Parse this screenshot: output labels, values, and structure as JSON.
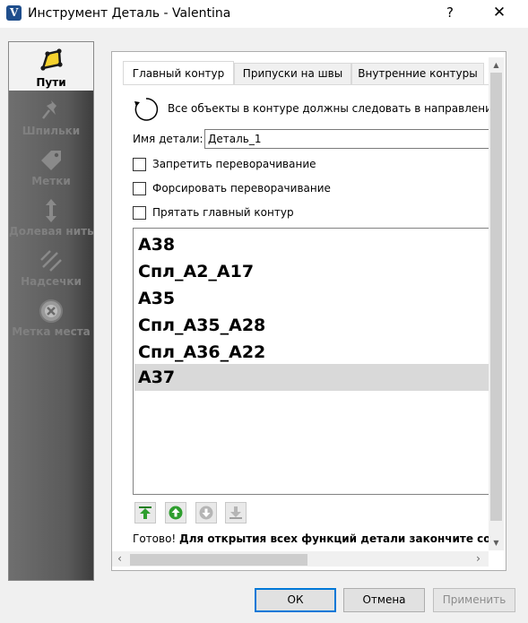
{
  "window": {
    "title": "Инструмент Деталь - Valentina",
    "help_glyph": "?",
    "close_glyph": "✕"
  },
  "sidebar": {
    "items": [
      {
        "label": "Пути",
        "icon": "path-icon",
        "active": true
      },
      {
        "label": "Шпильки",
        "icon": "pin-icon",
        "active": false
      },
      {
        "label": "Метки",
        "icon": "label-tag-icon",
        "active": false
      },
      {
        "label": "Долевая нить",
        "icon": "grainline-icon",
        "active": false
      },
      {
        "label": "Надсечки",
        "icon": "notches-icon",
        "active": false
      },
      {
        "label": "Метка места",
        "icon": "place-label-icon",
        "active": false
      }
    ]
  },
  "tabs": [
    {
      "label": "Главный контур",
      "active": true
    },
    {
      "label": "Припуски на швы",
      "active": false
    },
    {
      "label": "Внутренние контуры",
      "active": false
    }
  ],
  "main": {
    "direction_text": "Все объекты в контуре должны следовать в направлении по часовой стрелке.",
    "name_label": "Имя детали:",
    "name_value": "Деталь_1",
    "checkboxes": [
      {
        "label": "Запретить переворачивание",
        "checked": false
      },
      {
        "label": "Форсировать переворачивание",
        "checked": false
      },
      {
        "label": "Прятать главный контур",
        "checked": false
      }
    ],
    "list": [
      {
        "text": "А38",
        "selected": false
      },
      {
        "text": "Спл_А2_А17",
        "selected": false
      },
      {
        "text": "А35",
        "selected": false
      },
      {
        "text": "Спл_А35_А28",
        "selected": false
      },
      {
        "text": "Спл_А36_А22",
        "selected": false
      },
      {
        "text": "А37",
        "selected": true
      }
    ],
    "move_buttons": [
      "move-top-icon",
      "move-up-icon",
      "move-down-icon",
      "move-bottom-icon"
    ],
    "status_ready": "Готово!",
    "status_message": "Для открытия всех функций детали закончите создание основного контура."
  },
  "footer": {
    "ok": "ОК",
    "cancel": "Отмена",
    "apply": "Применить"
  },
  "colors": {
    "accent": "#0078d7",
    "selection": "#d9d9d9",
    "sidebar_dark": "#5a5a5a",
    "move_green": "#2e9e2e"
  }
}
